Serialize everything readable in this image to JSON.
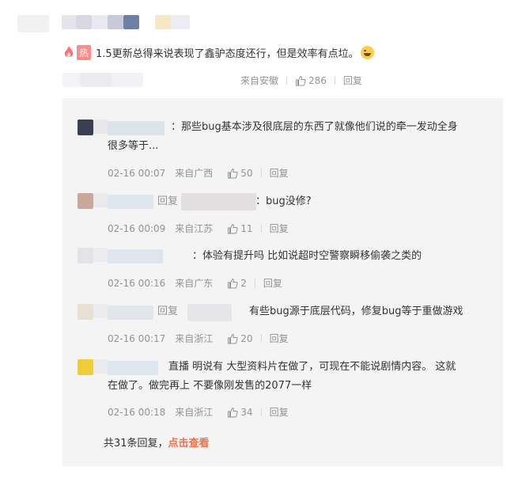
{
  "top_comment": {
    "badge": "热",
    "text": "1.5更新总得来说表现了鑫驴态度还行，但是效率有点垃。",
    "emoji": "laughing-emoji",
    "source": "来自安徽",
    "likes": "286",
    "reply_label": "回复"
  },
  "replies": [
    {
      "line1": "：那些bug基本涉及很底层的东西了就像他们说的牵一发动全身",
      "line2": "很多等于...",
      "time": "02-16 00:07",
      "source": "来自广西",
      "likes": "50",
      "reply_label": "回复"
    },
    {
      "prefix": "回复",
      "line1": "：bug没修?",
      "time": "02-16 00:09",
      "source": "来自江苏",
      "likes": "11",
      "reply_label": "回复"
    },
    {
      "line1": "：体验有提升吗 比如说超时空警察瞬移偷袭之类的",
      "time": "02-16 00:16",
      "source": "来自广东",
      "likes": "2",
      "reply_label": "回复"
    },
    {
      "prefix": "回复",
      "line1": "有些bug源于底层代码，修复bug等于重做游戏",
      "time": "02-16 00:17",
      "source": "来自浙江",
      "likes": "20",
      "reply_label": "回复"
    },
    {
      "line1": "直播 明说有 大型资料片在做了，可现在不能说剧情内容。  这就",
      "line2": "在做了。做完再上 不要像刚发售的2077一样",
      "time": "02-16 00:18",
      "source": "来自浙江",
      "likes": "34",
      "reply_label": "回复"
    }
  ],
  "footer": {
    "count_text": "共31条回复，",
    "link_text": "点击查看"
  },
  "colors": {
    "link": "#eb7350",
    "meta": "#939393",
    "reply_bg": "#f4f4f4",
    "hot_badge": "#ff8a8a"
  }
}
